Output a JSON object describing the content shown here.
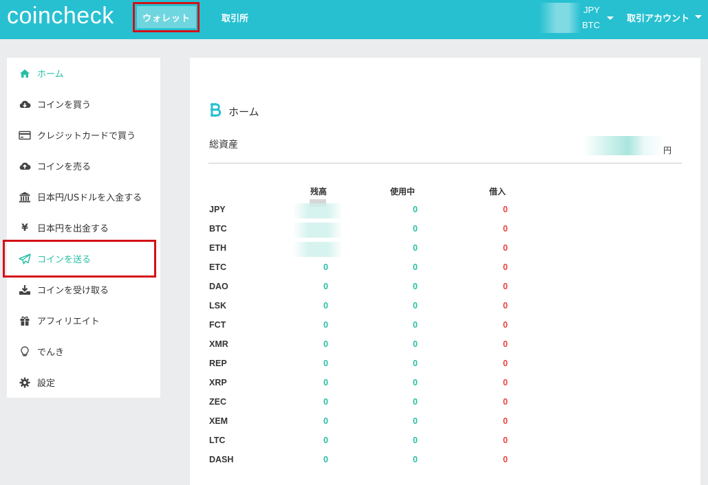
{
  "header": {
    "logo": "coincheck",
    "nav": {
      "wallet": "ウォレット",
      "trade": "取引所"
    },
    "currencies": {
      "jpy": "JPY",
      "btc": "BTC"
    },
    "account_menu": "取引アカウント"
  },
  "sidebar": {
    "items": [
      {
        "label": "ホーム",
        "icon": "home-icon",
        "active": true
      },
      {
        "label": "コインを買う",
        "icon": "cloud-download-icon",
        "active": false
      },
      {
        "label": "クレジットカードで買う",
        "icon": "credit-card-icon",
        "active": false
      },
      {
        "label": "コインを売る",
        "icon": "cloud-upload-icon",
        "active": false
      },
      {
        "label": "日本円/USドルを入金する",
        "icon": "bank-icon",
        "active": false
      },
      {
        "label": "日本円を出金する",
        "icon": "yen-icon",
        "active": false
      },
      {
        "label": "コインを送る",
        "icon": "paper-plane-icon",
        "active": true
      },
      {
        "label": "コインを受け取る",
        "icon": "download-tray-icon",
        "active": false
      },
      {
        "label": "アフィリエイト",
        "icon": "gift-icon",
        "active": false
      },
      {
        "label": "でんき",
        "icon": "lightbulb-icon",
        "active": false
      },
      {
        "label": "設定",
        "icon": "gear-icon",
        "active": false
      }
    ]
  },
  "main": {
    "title": "ホーム",
    "title_icon": "bitcoin-icon",
    "total_label": "総資産",
    "total_unit": "円",
    "columns": [
      "残高",
      "使用中",
      "借入"
    ],
    "rows": [
      {
        "coin": "JPY",
        "balance": "",
        "in_use": "0",
        "loan": "0"
      },
      {
        "coin": "BTC",
        "balance": "",
        "in_use": "0",
        "loan": "0"
      },
      {
        "coin": "ETH",
        "balance": "",
        "in_use": "0",
        "loan": "0"
      },
      {
        "coin": "ETC",
        "balance": "0",
        "in_use": "0",
        "loan": "0"
      },
      {
        "coin": "DAO",
        "balance": "0",
        "in_use": "0",
        "loan": "0"
      },
      {
        "coin": "LSK",
        "balance": "0",
        "in_use": "0",
        "loan": "0"
      },
      {
        "coin": "FCT",
        "balance": "0",
        "in_use": "0",
        "loan": "0"
      },
      {
        "coin": "XMR",
        "balance": "0",
        "in_use": "0",
        "loan": "0"
      },
      {
        "coin": "REP",
        "balance": "0",
        "in_use": "0",
        "loan": "0"
      },
      {
        "coin": "XRP",
        "balance": "0",
        "in_use": "0",
        "loan": "0"
      },
      {
        "coin": "ZEC",
        "balance": "0",
        "in_use": "0",
        "loan": "0"
      },
      {
        "coin": "XEM",
        "balance": "0",
        "in_use": "0",
        "loan": "0"
      },
      {
        "coin": "LTC",
        "balance": "0",
        "in_use": "0",
        "loan": "0"
      },
      {
        "coin": "DASH",
        "balance": "0",
        "in_use": "0",
        "loan": "0"
      }
    ]
  },
  "colors": {
    "brand": "#27c0d1",
    "positive": "#27c0a5",
    "negative": "#e9403b",
    "highlight": "#d40f16"
  }
}
